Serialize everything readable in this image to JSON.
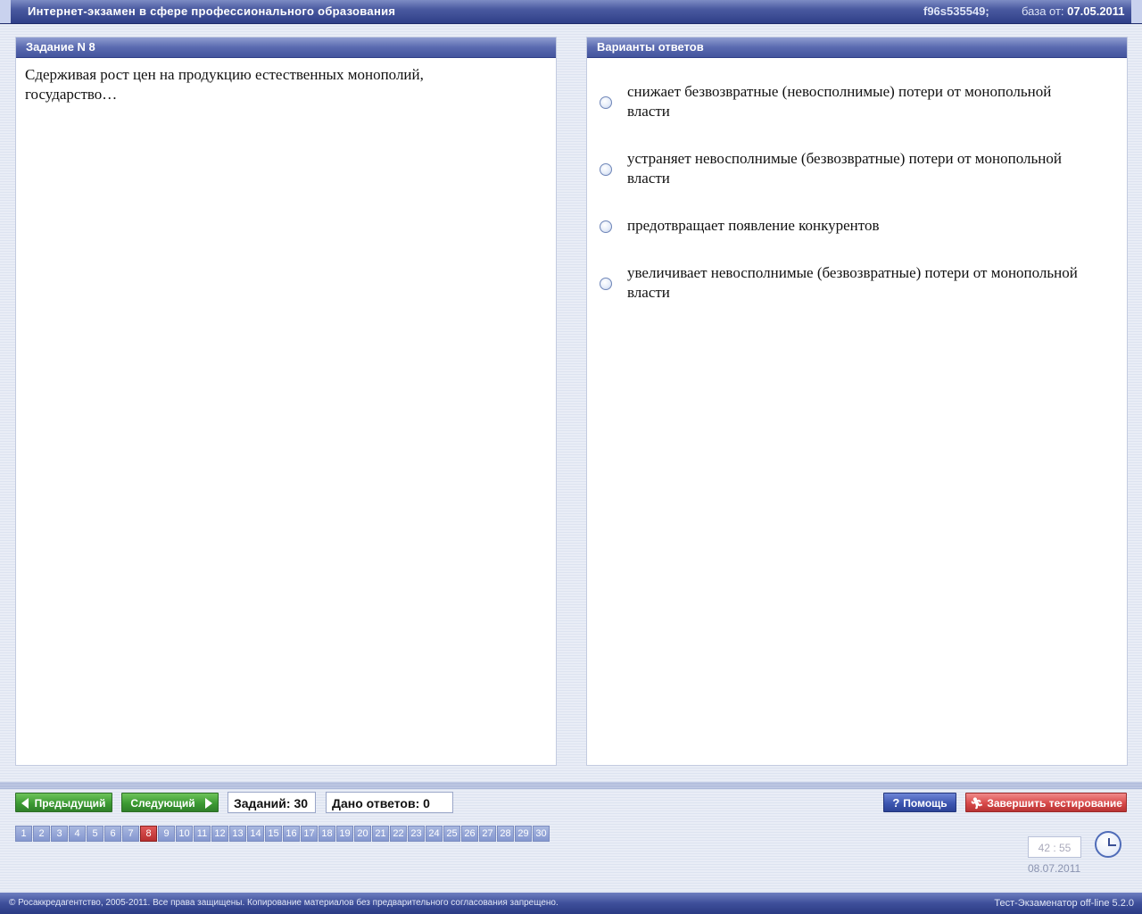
{
  "app": {
    "title": "Интернет-экзамен в сфере профессионального образования",
    "session_id": "f96s535549;",
    "base_label": "база от:",
    "base_date": "07.05.2011"
  },
  "task": {
    "header": "Задание N 8",
    "text": "Сдерживая рост цен на продукцию естественных монополий, государство…"
  },
  "answers": {
    "header": "Варианты ответов",
    "options": [
      "снижает безвозвратные (невосполнимые) потери от монопольной власти",
      "устраняет невосполнимые (безвозвратные) потери от монопольной власти",
      "предотвращает появление конкурентов",
      "увеличивает невосполнимые (безвозвратные) потери от монопольной власти"
    ]
  },
  "nav": {
    "prev_label": "Предыдущий",
    "next_label": "Следующий",
    "tasks_count": "Заданий: 30",
    "answers_given": "Дано ответов: 0",
    "help_label": "Помощь",
    "finish_label": "Завершить тестирование",
    "current_page": 8,
    "pages": [
      "1",
      "2",
      "3",
      "4",
      "5",
      "6",
      "7",
      "8",
      "9",
      "10",
      "11",
      "12",
      "13",
      "14",
      "15",
      "16",
      "17",
      "18",
      "19",
      "20",
      "21",
      "22",
      "23",
      "24",
      "25",
      "26",
      "27",
      "28",
      "29",
      "30"
    ]
  },
  "status": {
    "timer": "42 : 55",
    "date": "08.07.2011"
  },
  "footer": {
    "copyright": "© Росаккредагентство, 2005-2011. Все права защищены. Копирование материалов без предварительного согласования запрещено.",
    "version": "Тест-Экзаменатор off-line 5.2.0"
  },
  "colors": {
    "header_blue": "#2f3f88",
    "button_green": "#3c9a33",
    "button_blue": "#3d56b1",
    "button_red": "#d84a4a",
    "active_page": "#b82f2f"
  }
}
